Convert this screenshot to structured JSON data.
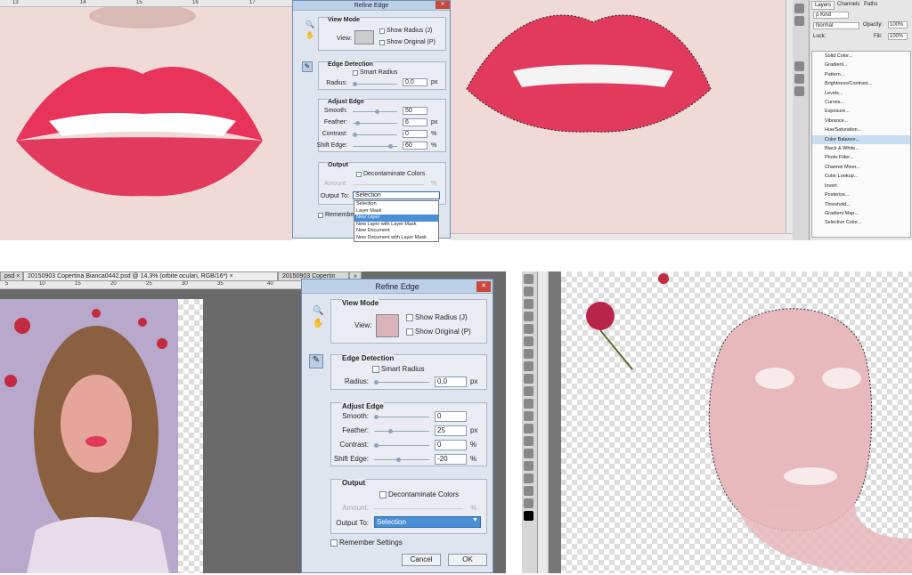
{
  "top_ruler": {
    "ticks": [
      "13",
      "14",
      "15",
      "16",
      "17"
    ]
  },
  "dialog_small": {
    "title": "Refine Edge",
    "close": "✕",
    "view_mode": {
      "title": "View Mode",
      "view_label": "View:",
      "show_radius": "Show Radius (J)",
      "show_original": "Show Original (P)"
    },
    "edge_detection": {
      "title": "Edge Detection",
      "smart_radius": "Smart Radius",
      "radius_label": "Radius:",
      "radius_value": "0,0",
      "radius_unit": "px"
    },
    "adjust_edge": {
      "title": "Adjust Edge",
      "smooth_label": "Smooth:",
      "smooth_value": "50",
      "smooth_level": 0.5,
      "feather_label": "Feather:",
      "feather_value": "6",
      "feather_unit": "px",
      "feather_level": 0.06,
      "contrast_label": "Contrast:",
      "contrast_value": "0",
      "contrast_unit": "%",
      "contrast_level": 0,
      "shift_label": "Shift Edge:",
      "shift_value": "60",
      "shift_unit": "%",
      "shift_level": 0.8
    },
    "output": {
      "title": "Output",
      "decontaminate": "Decontaminate Colors",
      "amount_label": "Amount:",
      "amount_unit": "%",
      "output_to_label": "Output To:",
      "output_to_value": "Selection"
    },
    "remember": "Remember",
    "menu_options": [
      "Selection",
      "Layer Mask",
      "New Layer",
      "New Layer with Layer Mask",
      "New Document",
      "New Document with Layer Mask"
    ],
    "menu_selected": "New Layer"
  },
  "layers_panel": {
    "tabs": [
      "Layers",
      "Channels",
      "Paths"
    ],
    "kind": "ρ Kind",
    "blend_mode": "Normal",
    "opacity_label": "Opacity:",
    "opacity_value": "100%",
    "lock_label": "Lock:",
    "fill_label": "Fill:",
    "fill_value": "100%",
    "adjustment_menu": [
      "Solid Color...",
      "Gradient...",
      "Pattern...",
      "Brightness/Contrast...",
      "Levels...",
      "Curves...",
      "Exposure...",
      "Vibrance...",
      "Hue/Saturation...",
      "Color Balance...",
      "Black & White...",
      "Photo Filter...",
      "Channel Mixer...",
      "Color Lookup...",
      "Invert",
      "Posterize...",
      "Threshold...",
      "Gradient Map...",
      "Selective Color..."
    ],
    "adjustment_highlight": "Color Balance..."
  },
  "bottom_tabs": [
    "psd ×",
    "20150903 Copertina Bianca0442.psd @ 14,3% (orbite oculari, RGB/16*) ×",
    "20150903 Copertin"
  ],
  "bottom_tab_more": "»",
  "bottom_ruler": {
    "ticks": [
      "5",
      "10",
      "15",
      "20",
      "25",
      "30",
      "35",
      "40"
    ]
  },
  "dialog_large": {
    "title": "Refine Edge",
    "close": "✕",
    "view_mode": {
      "title": "View Mode",
      "view_label": "View:",
      "show_radius": "Show Radius (J)",
      "show_original": "Show Original (P)"
    },
    "edge_detection": {
      "title": "Edge Detection",
      "smart_radius": "Smart Radius",
      "radius_label": "Radius:",
      "radius_value": "0,0",
      "radius_unit": "px"
    },
    "adjust_edge": {
      "title": "Adjust Edge",
      "smooth_label": "Smooth:",
      "smooth_value": "0",
      "smooth_level": 0,
      "feather_label": "Feather:",
      "feather_value": "25",
      "feather_unit": "px",
      "feather_level": 0.25,
      "contrast_label": "Contrast:",
      "contrast_value": "0",
      "contrast_unit": "%",
      "contrast_level": 0,
      "shift_label": "Shift Edge:",
      "shift_value": "-20",
      "shift_unit": "%",
      "shift_level": 0.4
    },
    "output": {
      "title": "Output",
      "decontaminate": "Decontaminate Colors",
      "amount_label": "Amount:",
      "amount_unit": "%",
      "output_to_label": "Output To:",
      "output_to_value": "Selection"
    },
    "remember": "Remember Settings",
    "cancel": "Cancel",
    "ok": "OK"
  },
  "colors": {
    "lips": "#e8345a",
    "skin": "#efdad7",
    "dialog": "#dfe5ee",
    "selection_blue": "#4a8fd6",
    "close_red": "#c9473c"
  }
}
